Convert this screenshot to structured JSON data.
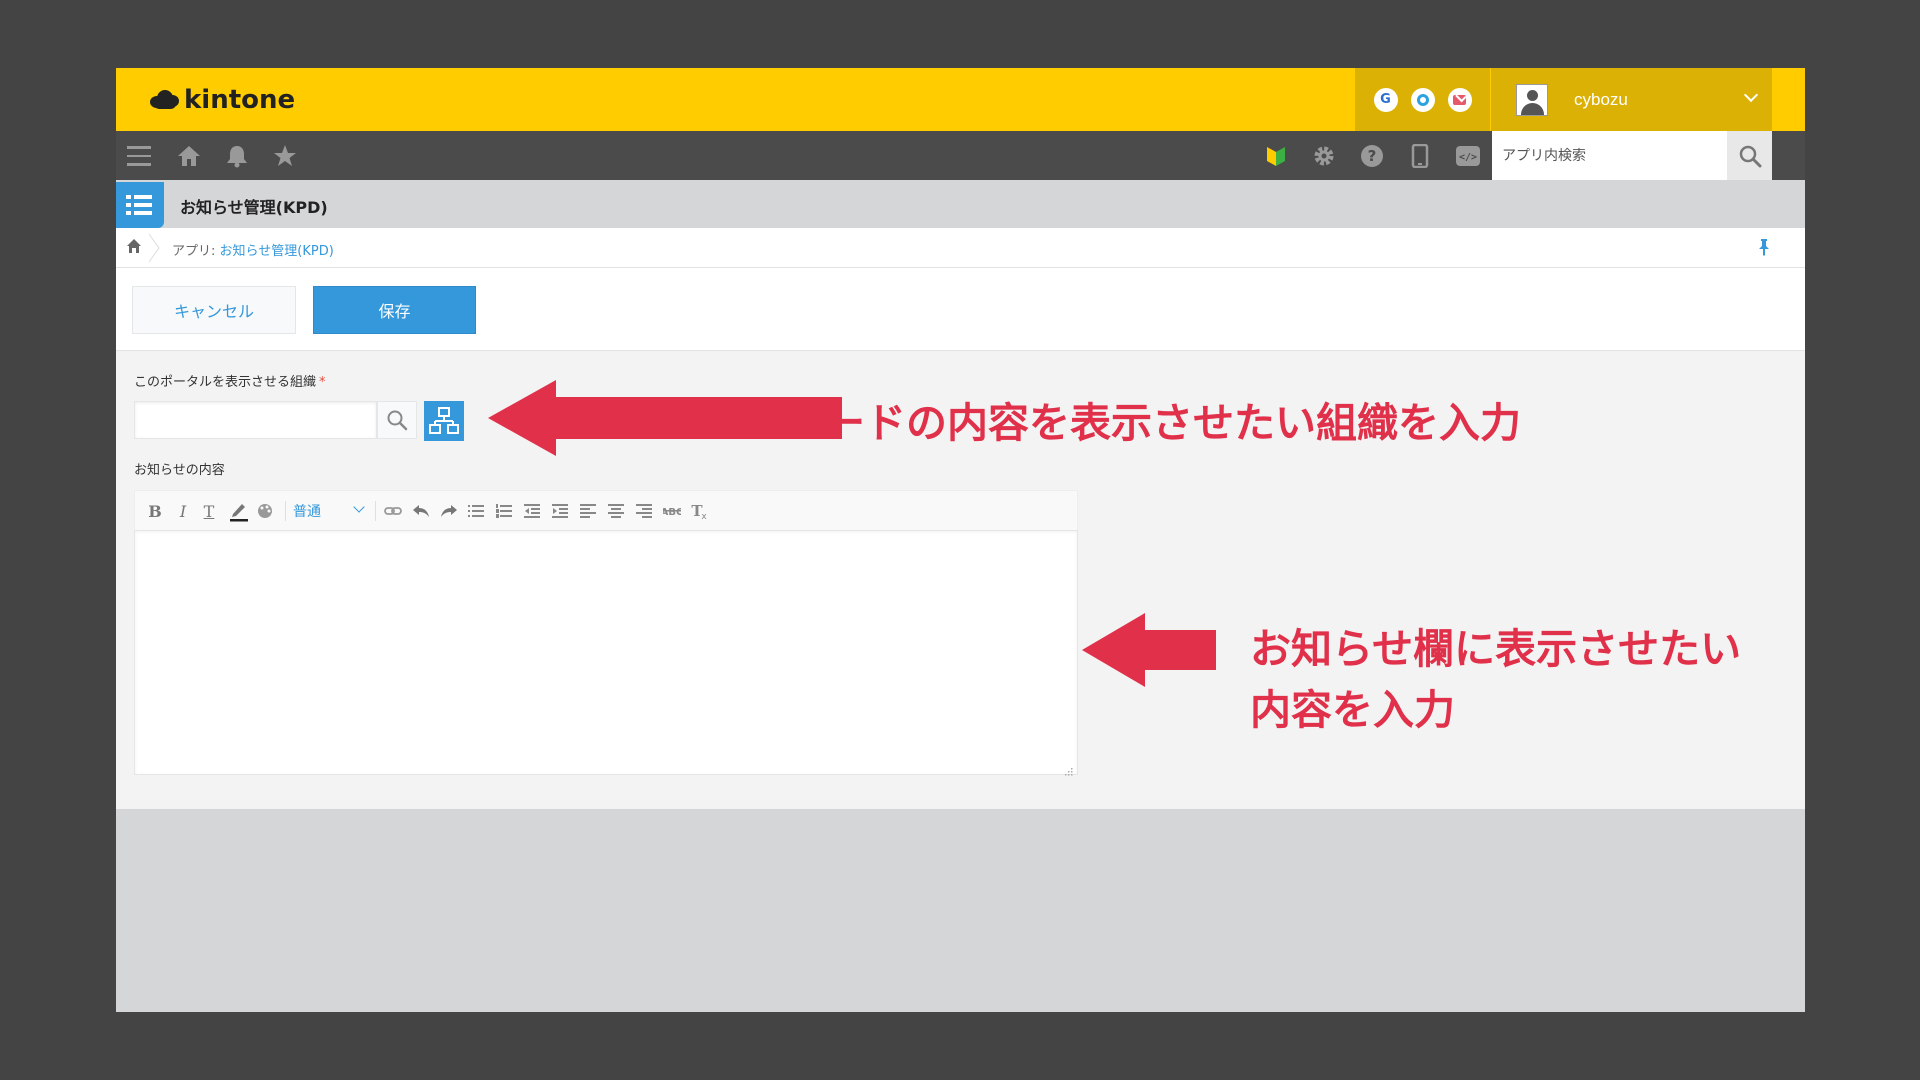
{
  "header": {
    "logo_text": "kintone",
    "services": [
      "G",
      "garoon",
      "mail"
    ],
    "username": "cybozu"
  },
  "toolbar": {
    "search_placeholder": "アプリ内検索"
  },
  "app": {
    "title": "お知らせ管理(KPD)"
  },
  "breadcrumb": {
    "prefix": "アプリ: ",
    "app_link": "お知らせ管理(KPD)"
  },
  "actions": {
    "cancel_label": "キャンセル",
    "save_label": "保存"
  },
  "form": {
    "org_field_label": "このポータルを表示させる組織",
    "required_mark": "*",
    "content_field_label": "お知らせの内容",
    "font_size_value": "普通"
  },
  "annotations": {
    "org_note": "レコードの内容を表示させたい組織を入力",
    "content_note_line1": "お知らせ欄に表示させたい",
    "content_note_line2": "内容を入力"
  },
  "colors": {
    "header_yellow": "#ffcc00",
    "toolbar_dark": "#4b4b4b",
    "accent_blue": "#3498db",
    "annotation_red": "#e0304a",
    "background": "#444444"
  }
}
